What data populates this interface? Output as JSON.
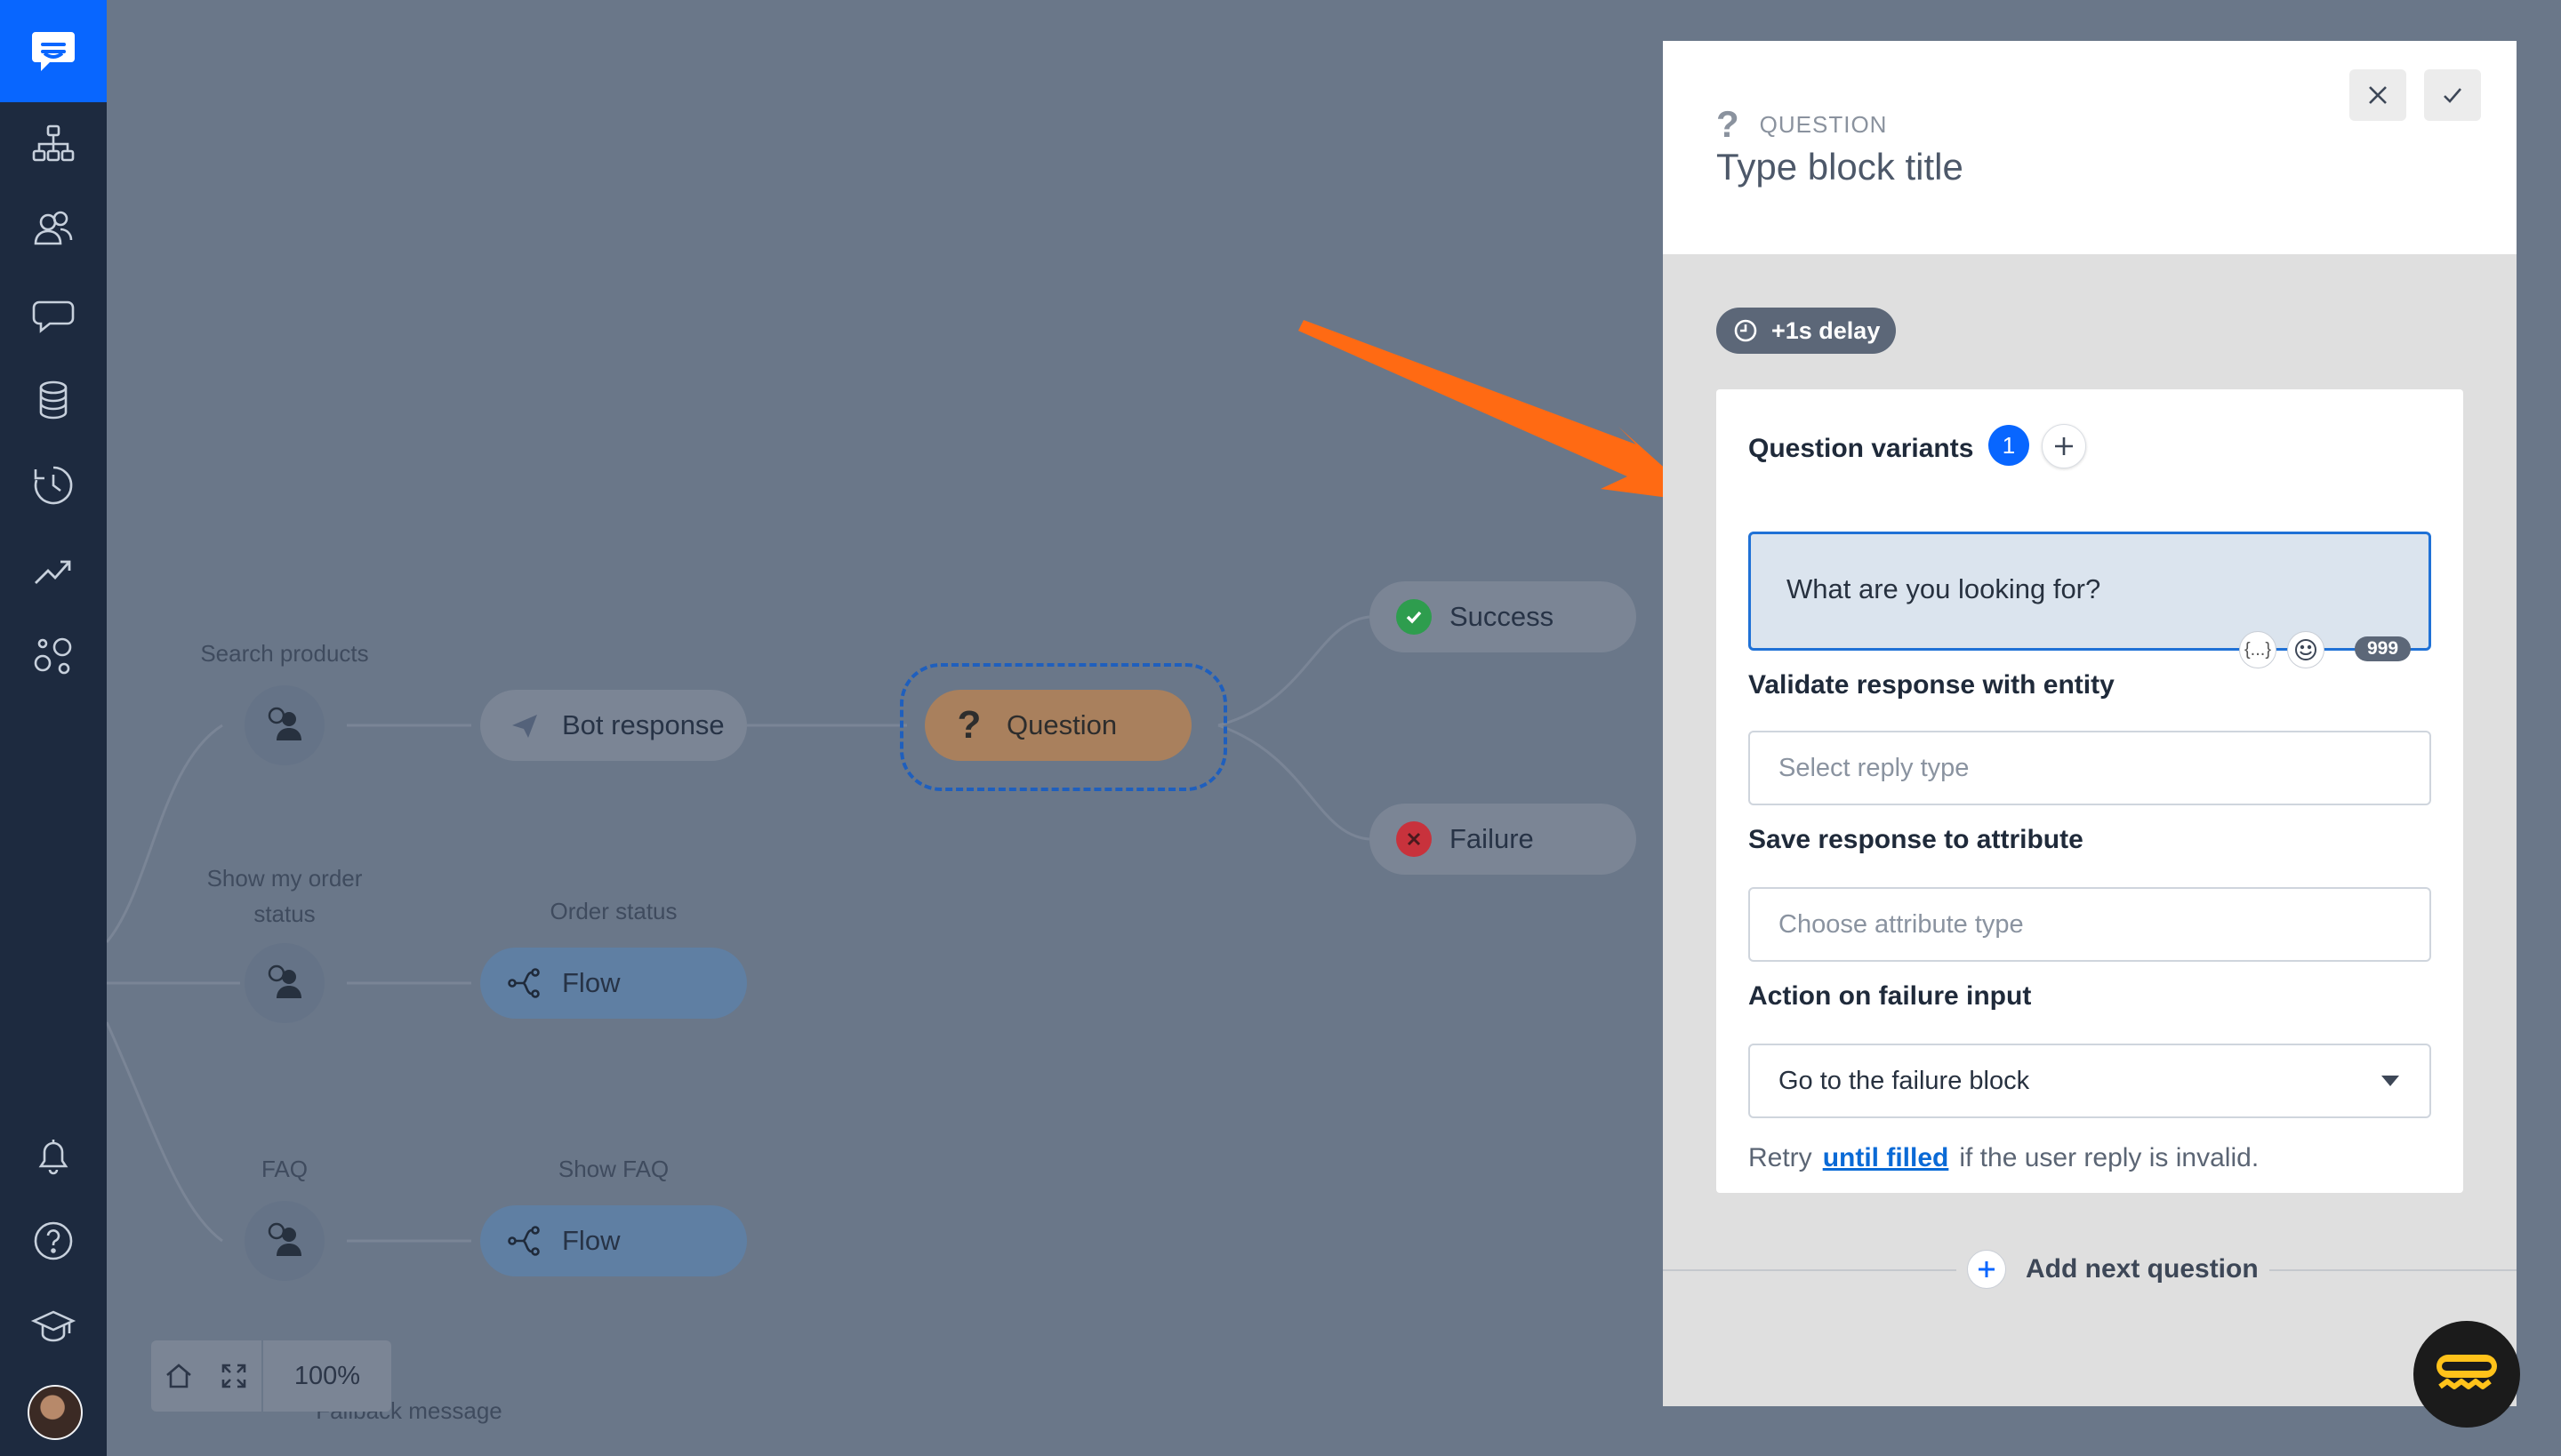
{
  "sidebar": {
    "logo_icon": "chat-bubble-logo-icon",
    "top_items": [
      "flow-tree-icon",
      "users-icon",
      "conversation-icon",
      "database-icon",
      "history-clock-icon",
      "analytics-trend-icon",
      "integrations-icon"
    ],
    "bottom_items": [
      "notifications-bell-icon",
      "help-circle-icon",
      "academy-cap-icon"
    ]
  },
  "canvas": {
    "nodes": {
      "search_products": {
        "label": "Search products"
      },
      "bot_response": {
        "label": "Bot response"
      },
      "question": {
        "label": "Question"
      },
      "success": {
        "label": "Success"
      },
      "failure": {
        "label": "Failure"
      },
      "show_order_status": {
        "label": "Show my order status"
      },
      "order_status": {
        "label": "Order status",
        "pill": "Flow"
      },
      "faq": {
        "label": "FAQ"
      },
      "show_faq": {
        "label": "Show FAQ",
        "pill": "Flow"
      },
      "fallback": {
        "label": "Fallback message"
      }
    },
    "zoom": "100%"
  },
  "panel": {
    "type_label": "QUESTION",
    "title": "Type block title",
    "delay": "+1s delay",
    "question_variants_label": "Question variants",
    "variants_count": "1",
    "variant_text": "What are you looking for?",
    "variables_button": "{...}",
    "char_counter": "999",
    "validate_label": "Validate response with entity",
    "validate_placeholder": "Select reply type",
    "save_label": "Save response to attribute",
    "save_placeholder": "Choose attribute type",
    "action_label": "Action on failure input",
    "action_value": "Go to the failure block",
    "retry_prefix": "Retry",
    "retry_link": "until filled",
    "retry_suffix": "if the user reply is invalid.",
    "add_next": "Add next question"
  },
  "colors": {
    "accent": "#0866ff",
    "sidebar_bg": "#1d2a3f",
    "overlay": "#6a7789",
    "annotation_arrow": "#ff6a13",
    "success": "#2e9d4e",
    "failure": "#c8323c"
  }
}
